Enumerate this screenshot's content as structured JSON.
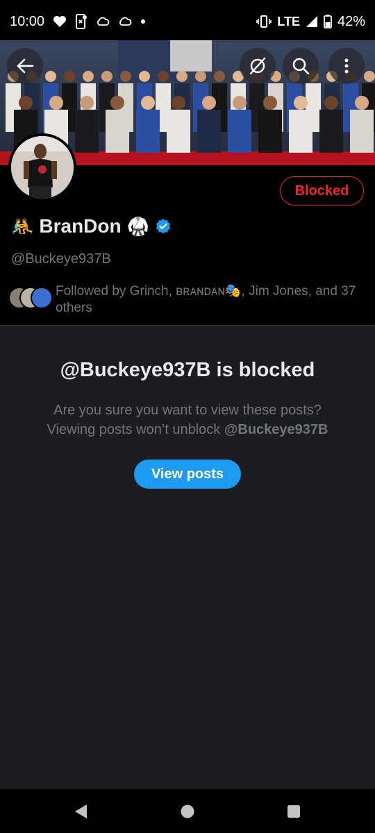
{
  "status_bar": {
    "time": "10:00",
    "network": "LTE",
    "battery": "42%",
    "icons": [
      "heart-icon",
      "phone-notification-icon",
      "cloud-icon",
      "cloud-icon",
      "dot-icon",
      "vibrate-icon",
      "signal-icon",
      "battery-icon"
    ]
  },
  "header": {
    "back_icon": "arrow-left-icon",
    "actions": [
      "grok-icon",
      "search-icon",
      "more-vertical-icon"
    ]
  },
  "profile": {
    "name_emoji_left": "🤼",
    "display_name": "BranDon",
    "name_emoji_right": "🥋",
    "verified_icon": "verified-badge-icon",
    "handle": "@Buckeye937B",
    "blocked_label": "Blocked",
    "followed_by": "Followed by Grinch, ʙʀᴀɴᴅᴀɴ🎭, Jim Jones, and 37 others"
  },
  "blocked": {
    "title": "@Buckeye937B is blocked",
    "message_line1": "Are you sure you want to view these posts?",
    "message_line2_prefix": "Viewing posts won’t unblock ",
    "message_handle": "@Buckeye937B",
    "view_posts_label": "View posts"
  },
  "nav": {
    "buttons": [
      "back-triangle-icon",
      "home-circle-icon",
      "recents-square-icon"
    ]
  },
  "colors": {
    "accent": "#1d9bf0",
    "blocked": "#f4212e",
    "secondary_text": "#71767b",
    "panel": "#1c1d22"
  }
}
